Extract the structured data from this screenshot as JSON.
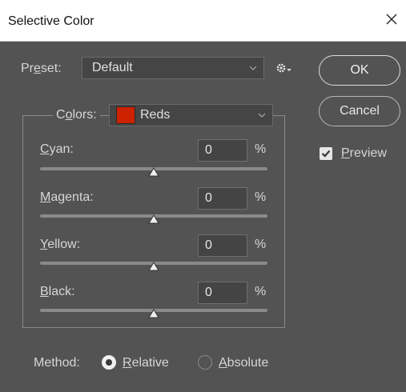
{
  "window": {
    "title": "Selective Color"
  },
  "preset": {
    "label_pre": "Pr",
    "label_ul": "e",
    "label_post": "set:",
    "value": "Default"
  },
  "buttons": {
    "ok": "OK",
    "cancel": "Cancel"
  },
  "preview": {
    "label_ul": "P",
    "label_rest": "review",
    "checked": true
  },
  "colors": {
    "label_pre": "C",
    "label_ul": "o",
    "label_post": "lors:",
    "value": "Reds",
    "swatch_color": "#cc2200"
  },
  "sliders": [
    {
      "label_ul": "C",
      "label_rest": "yan:",
      "value": "0",
      "unit": "%",
      "position": 0.5
    },
    {
      "label_ul": "M",
      "label_rest": "agenta:",
      "value": "0",
      "unit": "%",
      "position": 0.5
    },
    {
      "label_ul": "Y",
      "label_rest": "ellow:",
      "value": "0",
      "unit": "%",
      "position": 0.5
    },
    {
      "label_ul": "B",
      "label_rest": "lack:",
      "value": "0",
      "unit": "%",
      "position": 0.5
    }
  ],
  "method": {
    "label": "Method:",
    "relative": {
      "label_ul": "R",
      "label_rest": "elative",
      "selected": true
    },
    "absolute": {
      "label_ul": "A",
      "label_rest": "bsolute",
      "selected": false
    }
  },
  "icons": {
    "close": "close-icon",
    "gear": "gear-icon",
    "chevron": "chevron-down-icon",
    "check": "checkmark-icon"
  }
}
